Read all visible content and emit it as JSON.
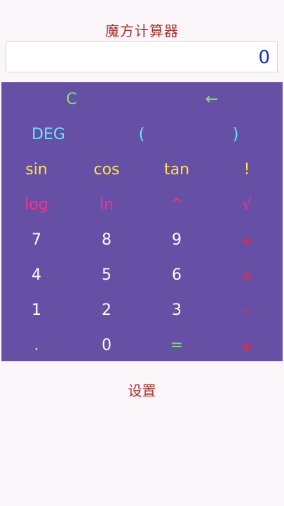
{
  "app": {
    "title": "魔方计算器",
    "display_value": "0",
    "settings_label": "设置"
  },
  "keys": {
    "clear": "C",
    "backspace": "←",
    "deg": "DEG",
    "paren_open": "(",
    "paren_close": ")",
    "sin": "sin",
    "cos": "cos",
    "tan": "tan",
    "factorial": "!",
    "log": "log",
    "ln": "ln",
    "power": "^",
    "sqrt": "√",
    "seven": "7",
    "eight": "8",
    "nine": "9",
    "divide": "÷",
    "four": "4",
    "five": "5",
    "six": "6",
    "multiply": "×",
    "one": "1",
    "two": "2",
    "three": "3",
    "minus": "−",
    "dot": ".",
    "zero": "0",
    "equals": "=",
    "plus": "+"
  },
  "colors": {
    "background": "#faf6fa",
    "keypad": "#6650a6",
    "title": "#a8322f",
    "display_text": "#1a2fb0",
    "green": "#7ee86a",
    "cyan": "#6be6ff",
    "yellow": "#ffe53a",
    "pink": "#ff2e83",
    "white": "#ffffff",
    "red": "#ff2230"
  }
}
